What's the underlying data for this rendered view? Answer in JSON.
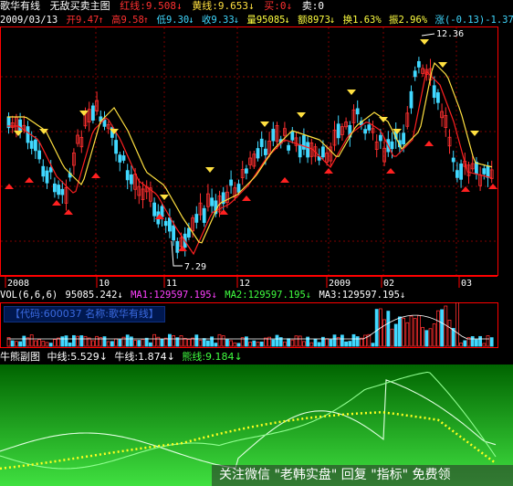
{
  "colors": {
    "background": "#000000",
    "main_frame": "#ff0000",
    "grid": "#800000",
    "up_candle": "#ff3030",
    "down_candle": "#40d8ff",
    "red_line": "#ff2020",
    "yellow_line": "#ffe040",
    "vol_label": "#ffffff",
    "ma1": "#ff40ff",
    "ma2": "#40ff40",
    "ma3": "#ffffff",
    "info_bg": "#001850",
    "info_text": "#3060d0",
    "green_panel_top": "#006400",
    "green_panel_bottom": "#40e040",
    "dot_line": "#ffff20",
    "watermark_text": "#ffffff"
  },
  "header": {
    "stock_name": "歌华有线",
    "indicator": "无敌买卖主图",
    "red_line_label": "红线:",
    "red_line_value": "9.508",
    "yellow_line_label": "黄线:",
    "yellow_line_value": "9.653",
    "buy_label": "买:",
    "buy_value": "0",
    "sell_label": "卖:",
    "sell_value": "0"
  },
  "quote": {
    "date": "2009/03/13",
    "open": "开9.47",
    "high": "高9.58",
    "low": "低9.30",
    "close": "收9.33",
    "volume": "量95085",
    "amount": "额8973",
    "turnover": "换1.63%",
    "amplitude": "振2.96%",
    "change": "涨(-0.13)-1.37%",
    "extra": "指"
  },
  "price_annotations": {
    "high": "12.36",
    "low": "7.29"
  },
  "time_axis": [
    "2008",
    "10",
    "11",
    "12",
    "2009",
    "02",
    "03"
  ],
  "volume_header": {
    "label": "VOL(6,6,6)",
    "value": "95085.242",
    "ma1": "MA1:129597.195",
    "ma2": "MA2:129597.195",
    "ma3": "MA3:129597.195"
  },
  "info_box": {
    "code_label": "【代码:600037",
    "name_label": "名称:歌华有线】"
  },
  "sub_header": {
    "title": "牛熊副图",
    "mid_line": "中线:5.529",
    "bull_line": "牛线:1.874",
    "bear_line": "熊线:9.184"
  },
  "watermark": "关注微信 \"老韩实盘\" 回复 \"指标\" 免费领",
  "chart_data": {
    "type": "candlestick",
    "title": "歌华有线",
    "price_range": [
      7.29,
      12.36
    ],
    "x_tick_labels": [
      "2008",
      "10",
      "11",
      "12",
      "2009",
      "02",
      "03"
    ],
    "last_bar": {
      "date": "2009/03/13",
      "open": 9.47,
      "high": 9.58,
      "low": 9.3,
      "close": 9.33,
      "volume": 95085
    },
    "series": [
      {
        "name": "红线",
        "last_value": 9.508
      },
      {
        "name": "黄线",
        "last_value": 9.653
      },
      {
        "name": "MA1",
        "last_value": 129597.195
      },
      {
        "name": "MA2",
        "last_value": 129597.195
      },
      {
        "name": "MA3",
        "last_value": 129597.195
      },
      {
        "name": "中线",
        "last_value": 5.529
      },
      {
        "name": "牛线",
        "last_value": 1.874
      },
      {
        "name": "熊线",
        "last_value": 9.184
      }
    ]
  }
}
